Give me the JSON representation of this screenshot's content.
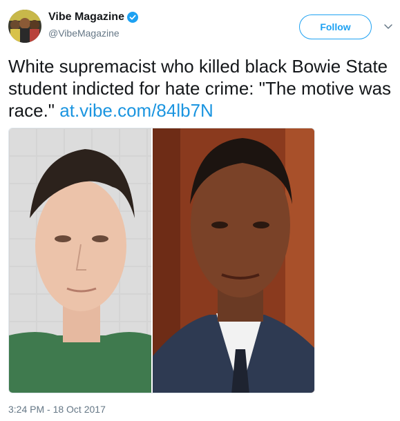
{
  "author": {
    "display_name": "Vibe Magazine",
    "handle": "@VibeMagazine",
    "verified": true,
    "avatar_icon": "vibe-avatar-icon"
  },
  "actions": {
    "follow_label": "Follow",
    "menu_icon": "chevron-down-icon"
  },
  "tweet": {
    "text": "White supremacist who killed black Bowie State student indicted for hate crime: \"The motive was race.\" ",
    "link_text": "at.vibe.com/84lb7N",
    "timestamp": "3:24 PM - 18 Oct 2017"
  },
  "media": {
    "images": [
      "left-portrait",
      "right-portrait"
    ]
  },
  "colors": {
    "accent": "#1da1f2",
    "link": "#1b95e0",
    "muted": "#657786",
    "text": "#14171a"
  }
}
